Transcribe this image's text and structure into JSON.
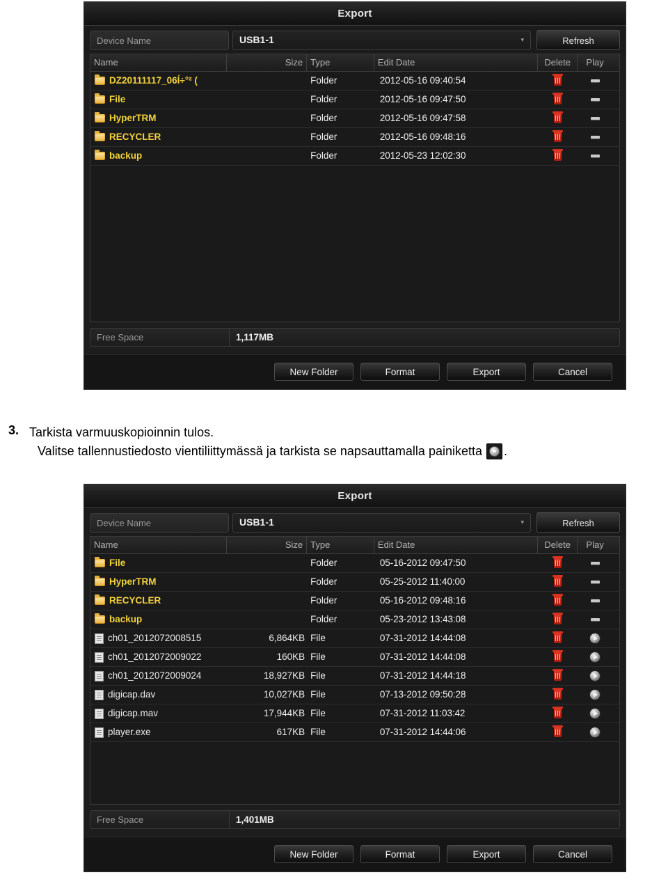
{
  "dialogs": [
    {
      "title": "Export",
      "device": {
        "label": "Device Name",
        "value": "USB1-1",
        "caret": "chevron-down-icon",
        "refresh_label": "Refresh"
      },
      "columns": {
        "name": "Name",
        "size": "Size",
        "type": "Type",
        "date": "Edit Date",
        "delete": "Delete",
        "play": "Play"
      },
      "rows": [
        {
          "icon": "folder-icon",
          "name": "DZ20111117_06Í÷°² (",
          "size": "",
          "type": "Folder",
          "date": "2012-05-16 09:40:54",
          "delete": "trash-icon",
          "play": "dash-icon"
        },
        {
          "icon": "folder-icon",
          "name": "File",
          "size": "",
          "type": "Folder",
          "date": "2012-05-16 09:47:50",
          "delete": "trash-icon",
          "play": "dash-icon"
        },
        {
          "icon": "folder-icon",
          "name": "HyperTRM",
          "size": "",
          "type": "Folder",
          "date": "2012-05-16 09:47:58",
          "delete": "trash-icon",
          "play": "dash-icon"
        },
        {
          "icon": "folder-icon",
          "name": "RECYCLER",
          "size": "",
          "type": "Folder",
          "date": "2012-05-16 09:48:16",
          "delete": "trash-icon",
          "play": "dash-icon"
        },
        {
          "icon": "folder-icon",
          "name": "backup",
          "size": "",
          "type": "Folder",
          "date": "2012-05-23 12:02:30",
          "delete": "trash-icon",
          "play": "dash-icon"
        }
      ],
      "free_space": {
        "label": "Free Space",
        "value": "1,117MB"
      },
      "buttons": [
        "New Folder",
        "Format",
        "Export",
        "Cancel"
      ]
    },
    {
      "title": "Export",
      "device": {
        "label": "Device Name",
        "value": "USB1-1",
        "caret": "chevron-down-icon",
        "refresh_label": "Refresh"
      },
      "columns": {
        "name": "Name",
        "size": "Size",
        "type": "Type",
        "date": "Edit Date",
        "delete": "Delete",
        "play": "Play"
      },
      "rows": [
        {
          "icon": "folder-icon",
          "name": "File",
          "size": "",
          "type": "Folder",
          "date": "05-16-2012 09:47:50",
          "delete": "trash-icon",
          "play": "dash-icon"
        },
        {
          "icon": "folder-icon",
          "name": "HyperTRM",
          "size": "",
          "type": "Folder",
          "date": "05-25-2012 11:40:00",
          "delete": "trash-icon",
          "play": "dash-icon"
        },
        {
          "icon": "folder-icon",
          "name": "RECYCLER",
          "size": "",
          "type": "Folder",
          "date": "05-16-2012 09:48:16",
          "delete": "trash-icon",
          "play": "dash-icon"
        },
        {
          "icon": "folder-icon",
          "name": "backup",
          "size": "",
          "type": "Folder",
          "date": "05-23-2012 13:43:08",
          "delete": "trash-icon",
          "play": "dash-icon"
        },
        {
          "icon": "file-icon",
          "name": "ch01_2012072008515",
          "size": "6,864KB",
          "type": "File",
          "date": "07-31-2012 14:44:08",
          "delete": "trash-icon",
          "play": "play-icon"
        },
        {
          "icon": "file-icon",
          "name": "ch01_2012072009022",
          "size": "160KB",
          "type": "File",
          "date": "07-31-2012 14:44:08",
          "delete": "trash-icon",
          "play": "play-icon"
        },
        {
          "icon": "file-icon",
          "name": "ch01_2012072009024",
          "size": "18,927KB",
          "type": "File",
          "date": "07-31-2012 14:44:18",
          "delete": "trash-icon",
          "play": "play-icon"
        },
        {
          "icon": "file-icon",
          "name": "digicap.dav",
          "size": "10,027KB",
          "type": "File",
          "date": "07-13-2012 09:50:28",
          "delete": "trash-icon",
          "play": "play-icon"
        },
        {
          "icon": "file-icon",
          "name": "digicap.mav",
          "size": "17,944KB",
          "type": "File",
          "date": "07-31-2012 11:03:42",
          "delete": "trash-icon",
          "play": "play-icon"
        },
        {
          "icon": "file-icon",
          "name": "player.exe",
          "size": "617KB",
          "type": "File",
          "date": "07-31-2012 14:44:06",
          "delete": "trash-icon",
          "play": "play-icon"
        }
      ],
      "free_space": {
        "label": "Free Space",
        "value": "1,401MB"
      },
      "buttons": [
        "New Folder",
        "Format",
        "Export",
        "Cancel"
      ]
    }
  ],
  "instruction": {
    "number": "3.",
    "line1": "Tarkista varmuuskopioinnin tulos.",
    "line2_before": "Valitse tallennustiedosto vientiliittymässä ja tarkista se napsauttamalla painiketta",
    "inline_icon": "play-icon",
    "line2_after": "."
  }
}
